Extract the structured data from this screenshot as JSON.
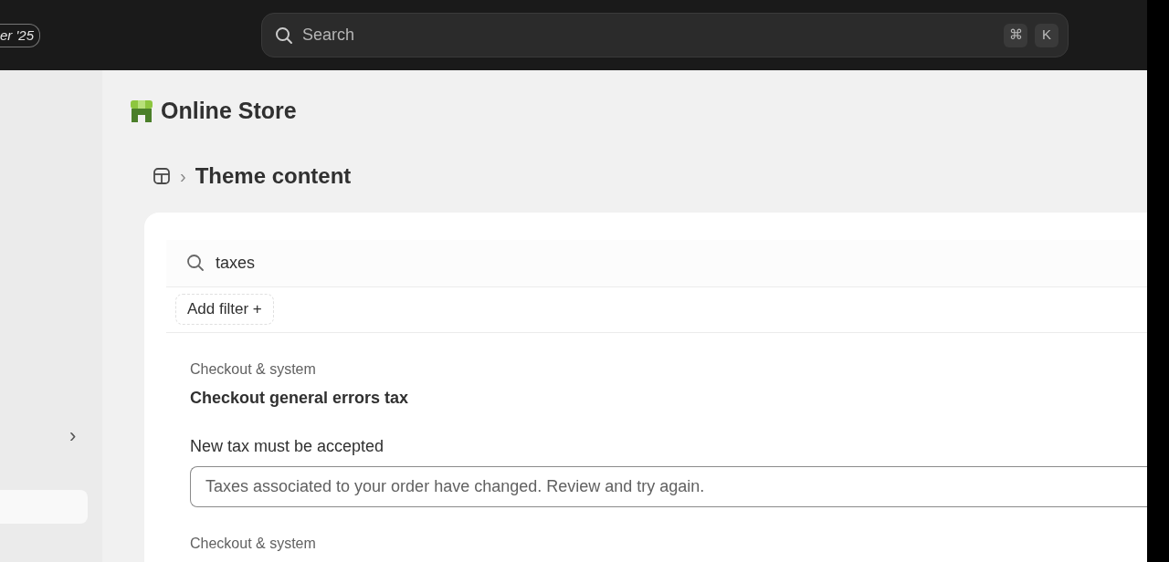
{
  "topbar": {
    "badge": "er '25",
    "search": {
      "placeholder": "Search"
    },
    "shortcut_keys": [
      "⌘",
      "K"
    ]
  },
  "app": {
    "title": "Online Store"
  },
  "breadcrumb": {
    "separator": "›",
    "title": "Theme content"
  },
  "filter": {
    "search_value": "taxes",
    "add_filter": "Add filter",
    "add_icon": "+"
  },
  "sidebar": {
    "chevron": "›"
  },
  "results": [
    {
      "category": "Checkout & system",
      "title": "Checkout general errors tax",
      "field_label": "New tax must be accepted",
      "field_value": "Taxes associated to your order have changed. Review and try again."
    },
    {
      "category": "Checkout & system"
    }
  ]
}
